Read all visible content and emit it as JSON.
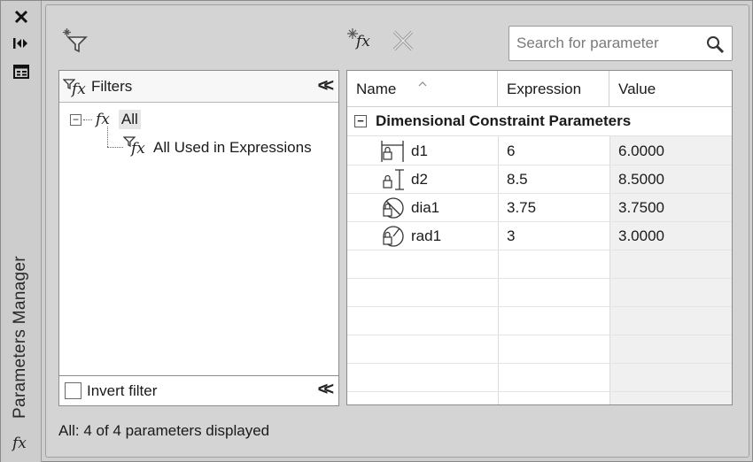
{
  "strip": {
    "title": "Parameters Manager",
    "fx_label": "fx"
  },
  "toolbar": {
    "fx_label": "fx",
    "search_placeholder": "Search for parameter"
  },
  "filters": {
    "header_label": "Filters",
    "fx_label": "fx",
    "collapse_label": "<<",
    "tree": [
      {
        "label": "All",
        "expander": "−"
      },
      {
        "label": "All Used in Expressions"
      }
    ],
    "invert_label": "Invert filter"
  },
  "grid": {
    "columns": [
      "Name",
      "Expression",
      "Value"
    ],
    "group_label": "Dimensional Constraint Parameters",
    "group_expander": "−",
    "rows": [
      {
        "name": "d1",
        "expression": "6",
        "value": "6.0000",
        "icon": "linear-horizontal-constraint-icon"
      },
      {
        "name": "d2",
        "expression": "8.5",
        "value": "8.5000",
        "icon": "linear-vertical-constraint-icon"
      },
      {
        "name": "dia1",
        "expression": "3.75",
        "value": "3.7500",
        "icon": "diameter-constraint-icon"
      },
      {
        "name": "rad1",
        "expression": "3",
        "value": "3.0000",
        "icon": "radius-constraint-icon"
      }
    ]
  },
  "status": "All: 4 of 4 parameters displayed"
}
